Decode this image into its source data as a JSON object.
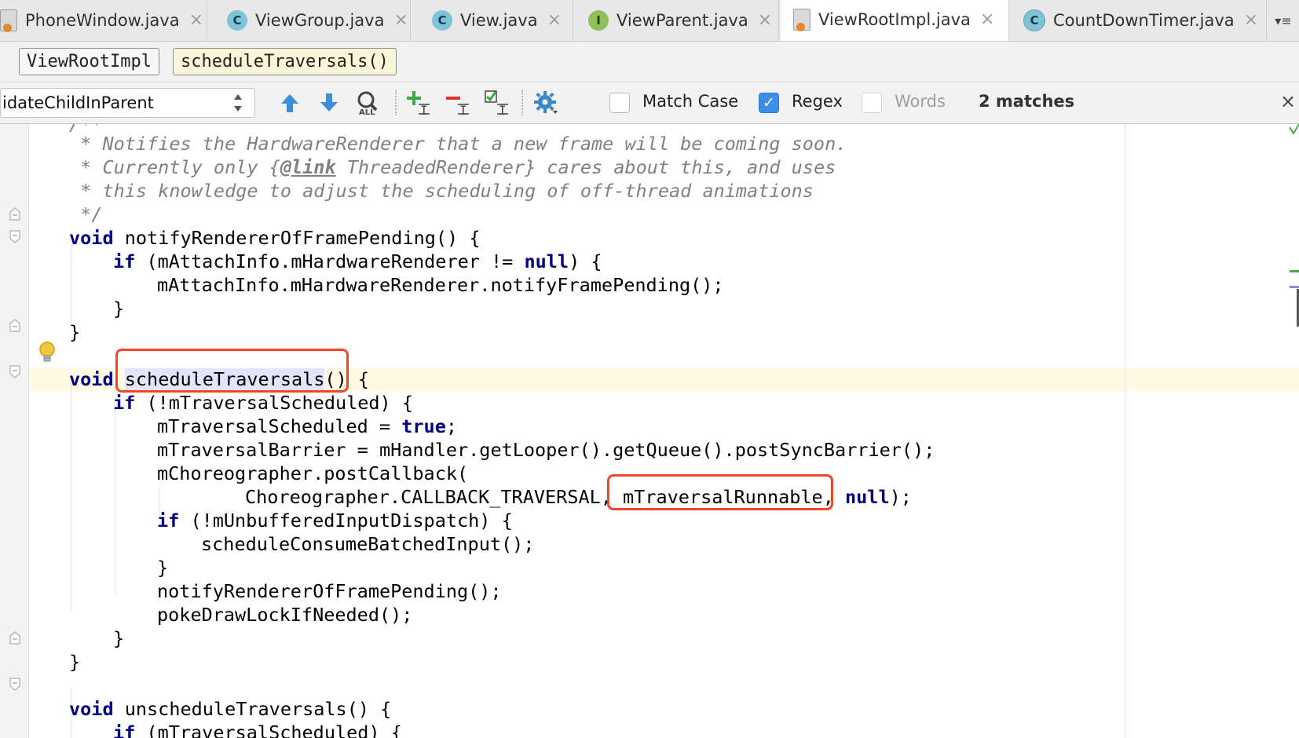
{
  "tabs": [
    {
      "label": "PhoneWindow.java",
      "icon": "java-file-icon",
      "active": false
    },
    {
      "label": "ViewGroup.java",
      "icon": "class-icon",
      "icon_letter": "C",
      "active": false
    },
    {
      "label": "View.java",
      "icon": "class-icon",
      "icon_letter": "C",
      "active": false
    },
    {
      "label": "ViewParent.java",
      "icon": "interface-icon",
      "icon_letter": "I",
      "active": false
    },
    {
      "label": "ViewRootImpl.java",
      "icon": "java-file-icon",
      "active": true
    },
    {
      "label": "CountDownTimer.java",
      "icon": "class-icon",
      "icon_letter": "C",
      "active": false
    }
  ],
  "breadcrumb": {
    "class_name": "ViewRootImpl",
    "method_name": "scheduleTraversals()"
  },
  "search": {
    "value": "idateChildInParent",
    "match_case_label": "Match Case",
    "match_case_checked": false,
    "regex_label": "Regex",
    "regex_checked": true,
    "words_label": "Words",
    "words_checked": false,
    "matches_text": "2 matches",
    "close_glyph": "×",
    "check_glyph": "✓"
  },
  "code": {
    "doc_line1": " * Notifies the HardwareRenderer that a new frame will be coming soon.",
    "doc_line2_pre": " * Currently only {",
    "doc_line2_tag": "@link",
    "doc_line2_post": " ThreadedRenderer} cares about this, and uses",
    "doc_line3": " * this knowledge to adjust the scheduling of off-thread animations",
    "doc_end": " */",
    "kw_void": "void",
    "kw_if": "if",
    "kw_null": "null",
    "kw_true": "true",
    "l_notify_sig": " notifyRendererOfFramePending() {",
    "l_if_hw": " (mAttachInfo.mHardwareRenderer != ",
    "l_if_hw_end": ") {",
    "l_notify_call": "mAttachInfo.mHardwareRenderer.notifyFramePending();",
    "close_brace": "}",
    "l_schedule_name": "scheduleTraversals",
    "l_schedule_rest": "() {",
    "l_if_sched": " (!mTraversalScheduled) {",
    "l_sched_assign": "mTraversalScheduled = ",
    "semicolon": ";",
    "l_barrier": "mTraversalBarrier = mHandler.getLooper().getQueue().postSyncBarrier();",
    "l_post": "mChoreographer.postCallback(",
    "l_post_args": "Choreographer.CALLBACK_TRAVERSAL, mTraversalRunnable, ",
    "l_post_end": ");",
    "l_if_unbuf": " (!mUnbufferedInputDispatch) {",
    "l_consume": "scheduleConsumeBatchedInput();",
    "l_notify2": "notifyRendererOfFramePending();",
    "l_poke": "pokeDrawLockIfNeeded();",
    "l_unsched_sig": " unscheduleTraversals() {",
    "l_if_unsched": " (mTraversalScheduled) {"
  },
  "colors": {
    "keyword": "#000080",
    "comment": "#808080",
    "highlight_box": "#f0472b",
    "regex_checkbox": "#3d8ee8"
  }
}
